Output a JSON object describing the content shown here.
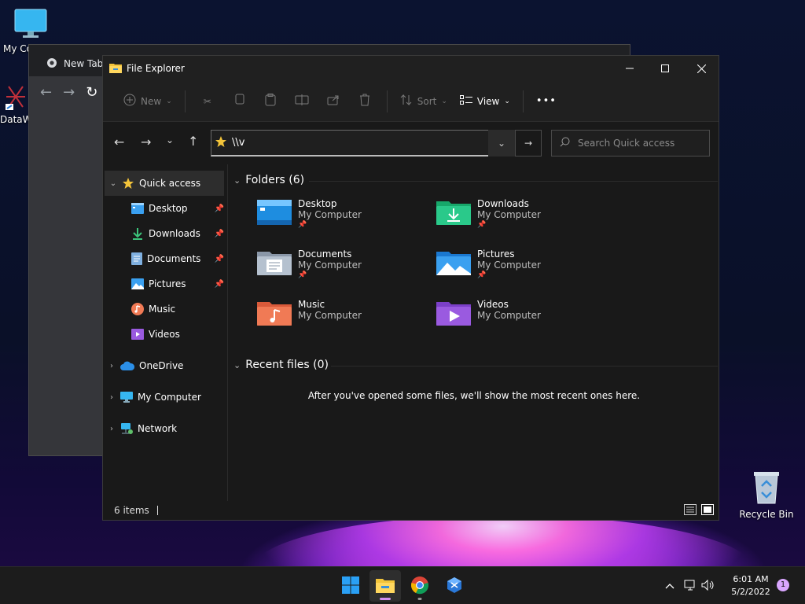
{
  "desktop": {
    "icons": [
      {
        "label": "My Co"
      },
      {
        "label": "DataW"
      },
      {
        "label": "Recycle Bin"
      }
    ]
  },
  "chrome": {
    "tab_title": "New Tab"
  },
  "explorer": {
    "title": "File Explorer",
    "commands": {
      "new": "New",
      "sort": "Sort",
      "view": "View",
      "more": "•••"
    },
    "address_value": "\\\\v",
    "search_placeholder": "Search Quick access",
    "sidebar": {
      "quick_access": "Quick access",
      "items": [
        {
          "label": "Desktop",
          "pinned": true
        },
        {
          "label": "Downloads",
          "pinned": true
        },
        {
          "label": "Documents",
          "pinned": true
        },
        {
          "label": "Pictures",
          "pinned": true
        },
        {
          "label": "Music",
          "pinned": false
        },
        {
          "label": "Videos",
          "pinned": false
        }
      ],
      "roots": [
        {
          "label": "OneDrive"
        },
        {
          "label": "My Computer"
        },
        {
          "label": "Network"
        }
      ]
    },
    "folders_header": "Folders (6)",
    "folders": [
      {
        "name": "Desktop",
        "location": "My Computer",
        "pinned": true
      },
      {
        "name": "Downloads",
        "location": "My Computer",
        "pinned": true
      },
      {
        "name": "Documents",
        "location": "My Computer",
        "pinned": true
      },
      {
        "name": "Pictures",
        "location": "My Computer",
        "pinned": true
      },
      {
        "name": "Music",
        "location": "My Computer",
        "pinned": false
      },
      {
        "name": "Videos",
        "location": "My Computer",
        "pinned": false
      }
    ],
    "recent_header": "Recent files (0)",
    "recent_empty": "After you've opened some files, we'll show the most recent ones here.",
    "status_items": "6 items"
  },
  "taskbar": {
    "time": "6:01 AM",
    "date": "5/2/2022",
    "notification_count": "1"
  },
  "colors": {
    "accent": "#d28ff0",
    "folder_yellow": "#f3c43a",
    "folder_blue": "#3aa0f0"
  }
}
